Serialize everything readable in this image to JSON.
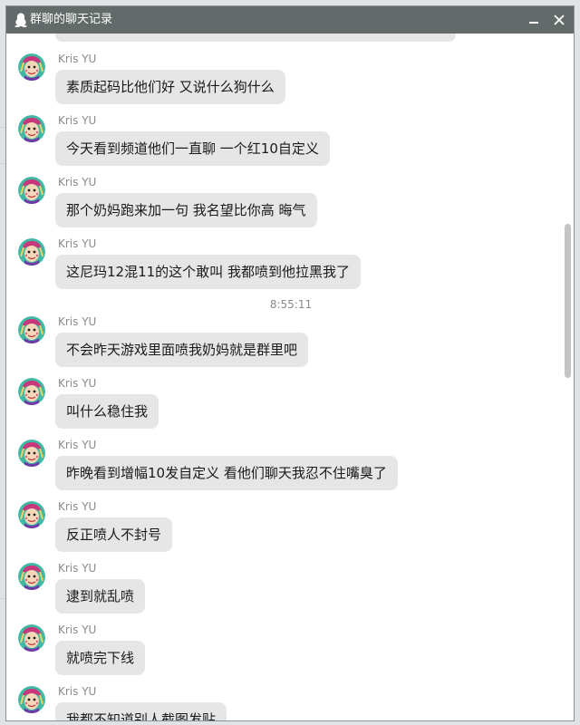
{
  "window": {
    "title": "群聊的聊天记录",
    "title_bar_color": "#626b69",
    "minimize_icon": "minimize-icon",
    "close_icon": "close-icon",
    "app_icon": "penguin-icon"
  },
  "timestamp": "8:55:11",
  "messages": [
    {
      "sender": "Kris YU",
      "text": "素质起码比他们好 又说什么狗什么"
    },
    {
      "sender": "Kris YU",
      "text": "今天看到频道他们一直聊 一个红10自定义"
    },
    {
      "sender": "Kris YU",
      "text": "那个奶妈跑来加一句 我名望比你高 晦气"
    },
    {
      "sender": "Kris YU",
      "text": "这尼玛12混11的这个敢叫 我都喷到他拉黑我了"
    },
    {
      "sender": "Kris YU",
      "text": "不会昨天游戏里面喷我奶妈就是群里吧"
    },
    {
      "sender": "Kris YU",
      "text": "叫什么稳住我"
    },
    {
      "sender": "Kris YU",
      "text": "昨晚看到增幅10发自定义 看他们聊天我忍不住嘴臭了"
    },
    {
      "sender": "Kris YU",
      "text": "反正喷人不封号"
    },
    {
      "sender": "Kris YU",
      "text": "逮到就乱喷"
    },
    {
      "sender": "Kris YU",
      "text": "就喷完下线"
    },
    {
      "sender": "Kris YU",
      "text": "我都不知道别人截图发贴"
    }
  ]
}
